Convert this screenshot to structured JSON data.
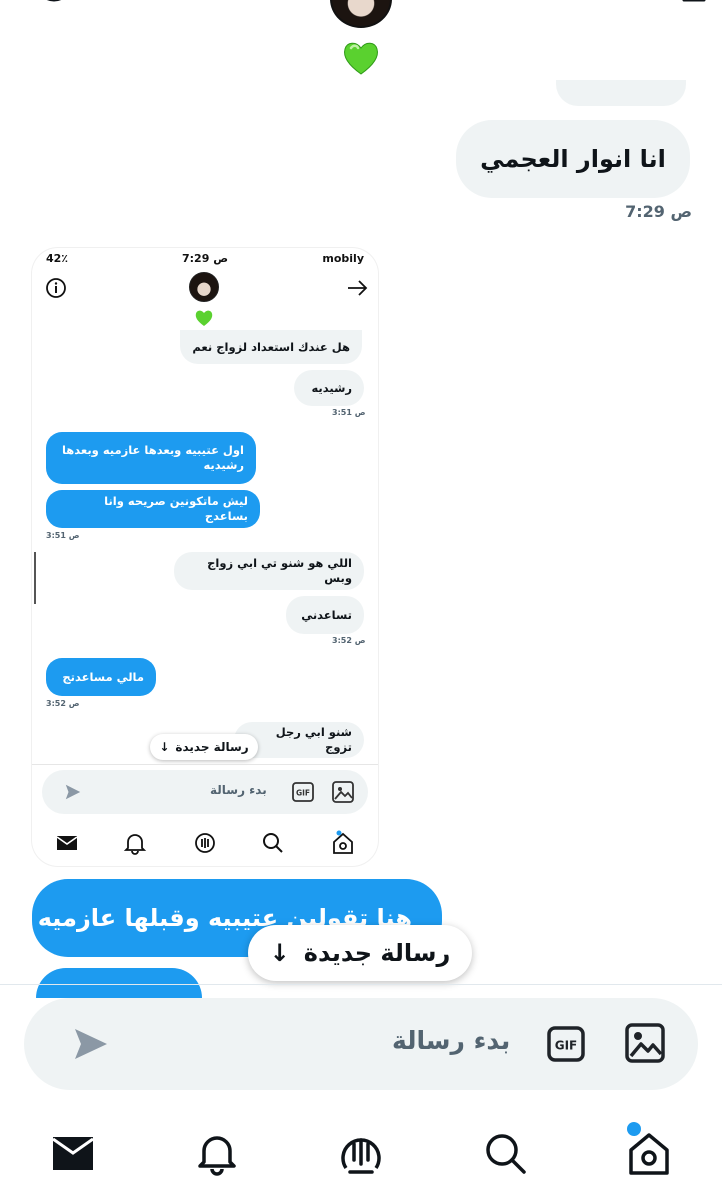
{
  "header": {
    "heart_emoji": "💚"
  },
  "conversation": {
    "received_message": "انا انوار العجمي",
    "received_time": "7:29 ص",
    "sent_message": "هنا تقولين عتيبيه وقبلها عازميه"
  },
  "embedded_screenshot": {
    "status_bar": {
      "battery": "42٪",
      "time": "7:29 ص",
      "carrier": "mobily"
    },
    "heart_emoji": "💚",
    "messages": [
      {
        "side": "received",
        "text": "هل عندك استعداد لزواج نعم"
      },
      {
        "side": "received",
        "text": "رشيديه",
        "time": "3:51 ص"
      },
      {
        "side": "sent",
        "text": "اول عتيبيه وبعدها عازميه وبعدها رشيديه"
      },
      {
        "side": "sent",
        "text": "ليش ماتكونين صريحه وانا بساعدج",
        "time": "3:51 ص"
      },
      {
        "side": "received",
        "text": "اللي هو شنو تي ابي زواج وبس"
      },
      {
        "side": "received",
        "text": "تساعدني",
        "time": "3:52 ص"
      },
      {
        "side": "sent",
        "text": "مالي مساعدتج",
        "time": "3:52 ص"
      },
      {
        "side": "received",
        "text": "شنو ابي رجل تزوج"
      }
    ],
    "new_message_pill": "رسالة جديدة",
    "compose_placeholder": "بدء رسالة"
  },
  "new_message_pill": {
    "label": "رسالة جديدة",
    "icon": "arrow-down-icon"
  },
  "composer": {
    "placeholder": "بدء رسالة",
    "icons": [
      "send-icon",
      "gif-icon",
      "image-icon"
    ]
  },
  "bottom_nav": {
    "items": [
      "messages-icon",
      "notifications-icon",
      "spaces-icon",
      "search-icon",
      "home-icon"
    ],
    "accent": "#1d9bf0"
  },
  "colors": {
    "accent": "#1d9bf0",
    "bubble_gray": "#eff3f4",
    "muted_text": "#536471"
  }
}
